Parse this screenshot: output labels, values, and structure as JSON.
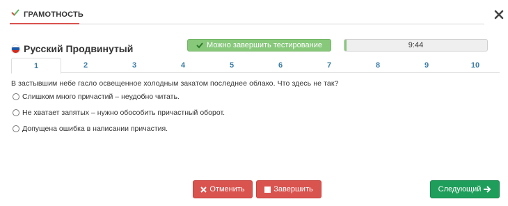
{
  "header": {
    "tab_label": "ГРАМОТНОСТЬ",
    "tab_icon": "check-icon",
    "close_icon": "close-icon"
  },
  "course": {
    "flag": "russian-flag-icon",
    "title": "Русский Продвинутый"
  },
  "status": {
    "finish_available": "Можно завершить тестирование",
    "timer": "9:44"
  },
  "question_tabs": [
    {
      "label": "1",
      "active": true
    },
    {
      "label": "2",
      "active": false
    },
    {
      "label": "3",
      "active": false
    },
    {
      "label": "4",
      "active": false
    },
    {
      "label": "5",
      "active": false
    },
    {
      "label": "6",
      "active": false
    },
    {
      "label": "7",
      "active": false
    },
    {
      "label": "8",
      "active": false
    },
    {
      "label": "9",
      "active": false
    },
    {
      "label": "10",
      "active": false
    }
  ],
  "question": {
    "text": "В застывшим небе гасло освещенное холодным закатом последнее облако. Что здесь не так?",
    "answers": [
      "Слишком много причастий – неудобно читать.",
      "Не хватает запятых – нужно обособить причастный оборот.",
      "Допущена ошибка в написании причастия."
    ]
  },
  "buttons": {
    "cancel": "Отменить",
    "finish": "Завершить",
    "next": "Следующий"
  },
  "colors": {
    "accent_red": "#d9534f",
    "success_green": "#87c87b",
    "next_green": "#1f9e5b",
    "tab_link": "#3a7ca5"
  }
}
